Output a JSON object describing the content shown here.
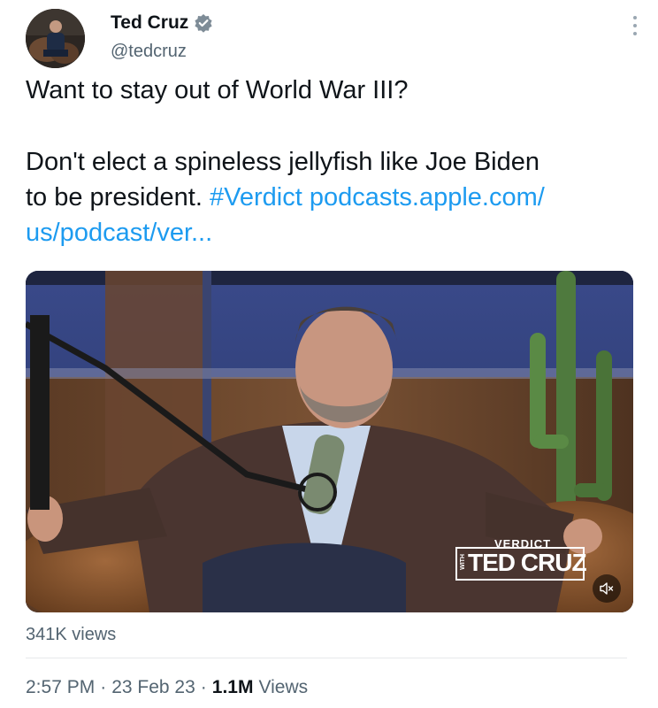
{
  "author": {
    "display_name": "Ted Cruz",
    "handle": "@tedcruz",
    "verified": true
  },
  "tweet": {
    "line1": "Want to stay out of World War III?",
    "line2": "Don't elect a spineless jellyfish like Joe Biden",
    "line3_text": "to be president. ",
    "hashtag": "#Verdict",
    "link_part1": "podcasts.apple.com/",
    "link_part2": "us/podcast/ver..."
  },
  "media": {
    "logo_top": "VERDICT",
    "logo_with": "WITH",
    "logo_name": "TED CRUZ",
    "mute_icon": "speaker-muted-icon"
  },
  "video_views": "341K views",
  "meta": {
    "time": "2:57 PM",
    "date": "23 Feb 23",
    "views_count": "1.1M",
    "views_label": "Views"
  },
  "colors": {
    "link": "#1d9bf0",
    "secondary_text": "#536471",
    "primary_text": "#0f1419"
  }
}
